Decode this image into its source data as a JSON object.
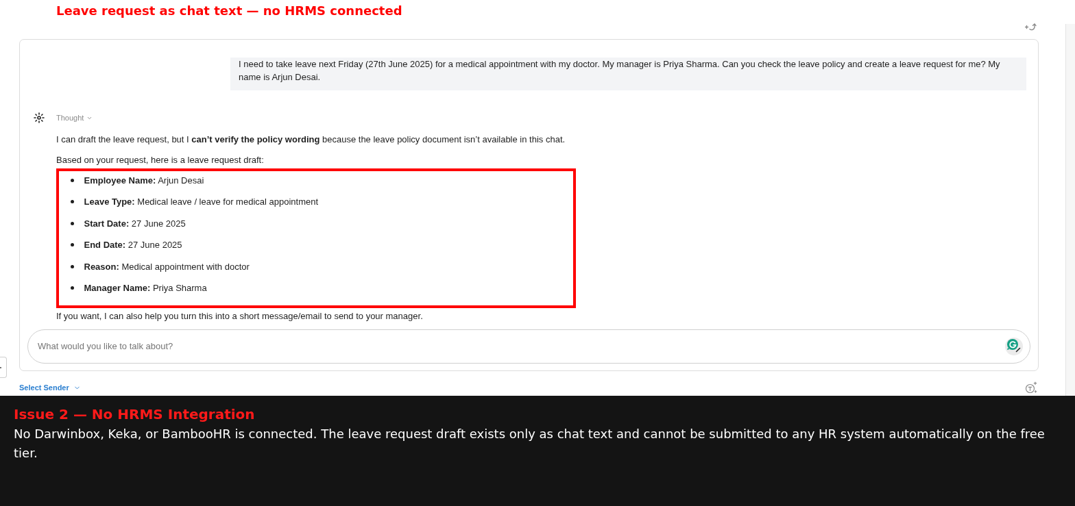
{
  "annotation_title": "Leave request as chat text — no HRMS connected",
  "chat": {
    "user_message": "I need to take leave next Friday (27th June 2025) for a medical appointment with my doctor. My manager is Priya Sharma. Can you check the leave policy and create a leave request for me? My name is Arjun Desai.",
    "thought_label": "Thought",
    "intro": "I can draft the leave request, but I **can’t verify the policy wording** because the leave policy document isn’t available in this chat.",
    "lead": "Based on your request, here is a leave request draft:",
    "draft_items": [
      "**Employee Name:** Arjun Desai",
      "**Leave Type:** Medical leave / leave for medical appointment",
      "**Start Date:** 27 June 2025",
      "**End Date:** 27 June 2025",
      "**Reason:** Medical appointment with doctor",
      "**Manager Name:** Priya Sharma"
    ],
    "closing": "If you want, I can also help you turn this into a short message/email to send to your manager.",
    "input": {
      "placeholder": "What would you like to talk about?"
    },
    "sender_select": "Select Sender"
  },
  "issue": {
    "title": "Issue 2 — No HRMS Integration",
    "body": "No Darwinbox, Keka, or BambooHR is connected. The leave request draft exists only as chat text and cannot be submitted to any HR system automatically on the free tier."
  }
}
